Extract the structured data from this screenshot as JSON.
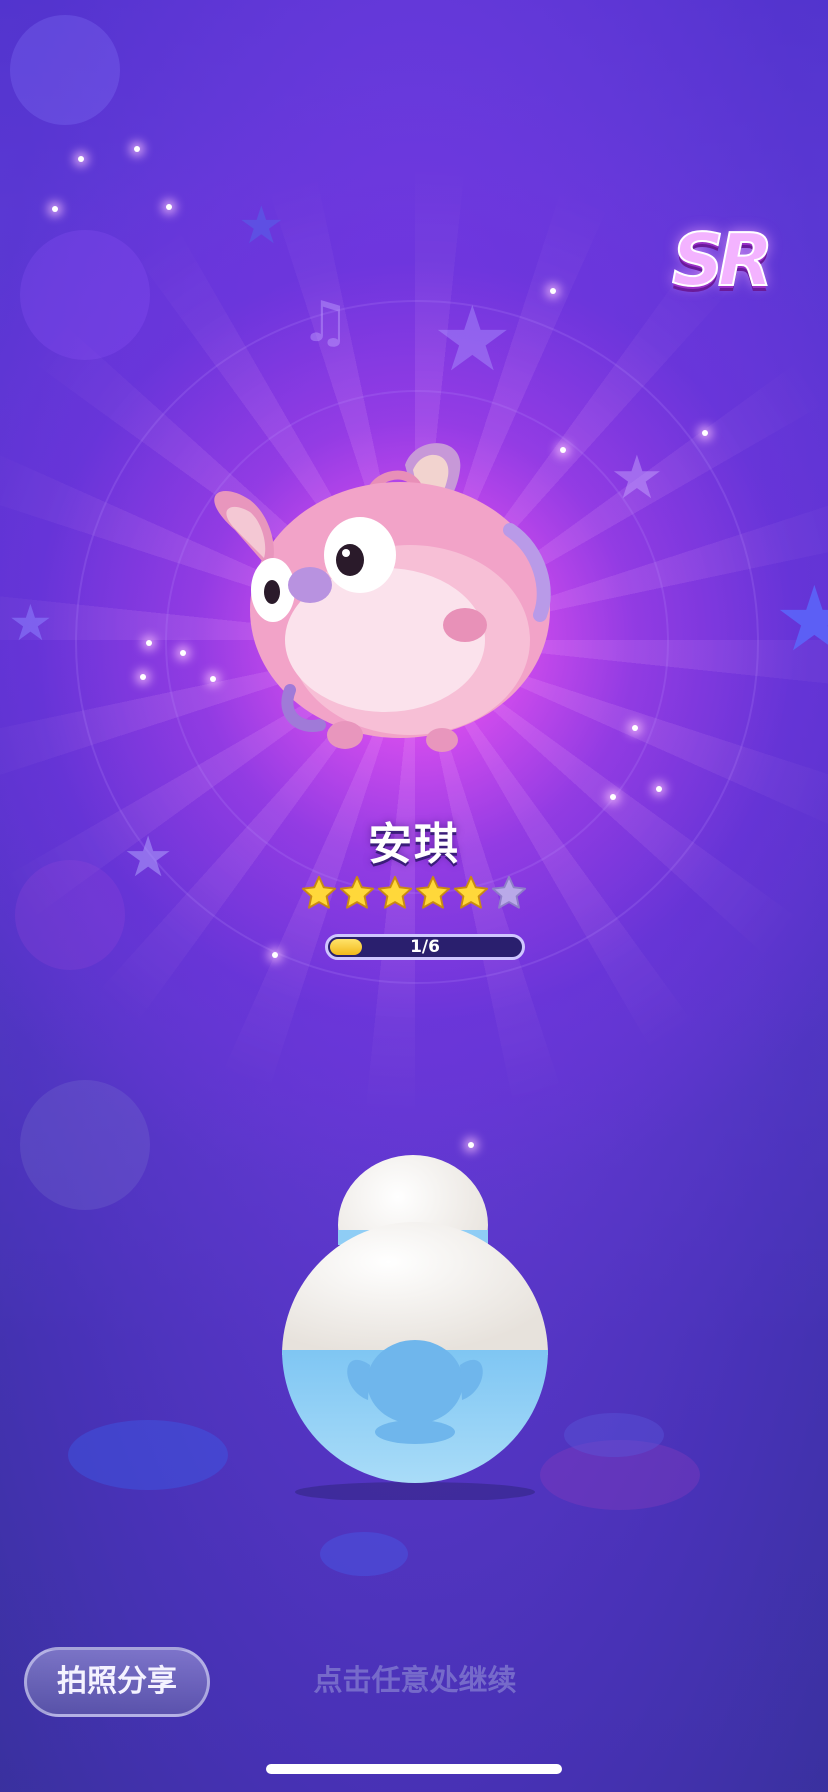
{
  "rarity_badge": "SR",
  "character": {
    "name": "安琪",
    "star_rating": 5,
    "star_max": 6,
    "progress": {
      "label": "1/6",
      "current": 1,
      "total": 6
    }
  },
  "actions": {
    "share_label": "拍照分享",
    "continue_hint": "点击任意处继续"
  },
  "colors": {
    "glow": "#f07cff",
    "background_top": "#4a37c9",
    "background_bottom": "#2b3088",
    "character_body": "#f2a3c8",
    "capsule_top": "#fbf8f3",
    "capsule_bottom": "#8fcdf5",
    "progress_fill": "#f7c82b"
  }
}
